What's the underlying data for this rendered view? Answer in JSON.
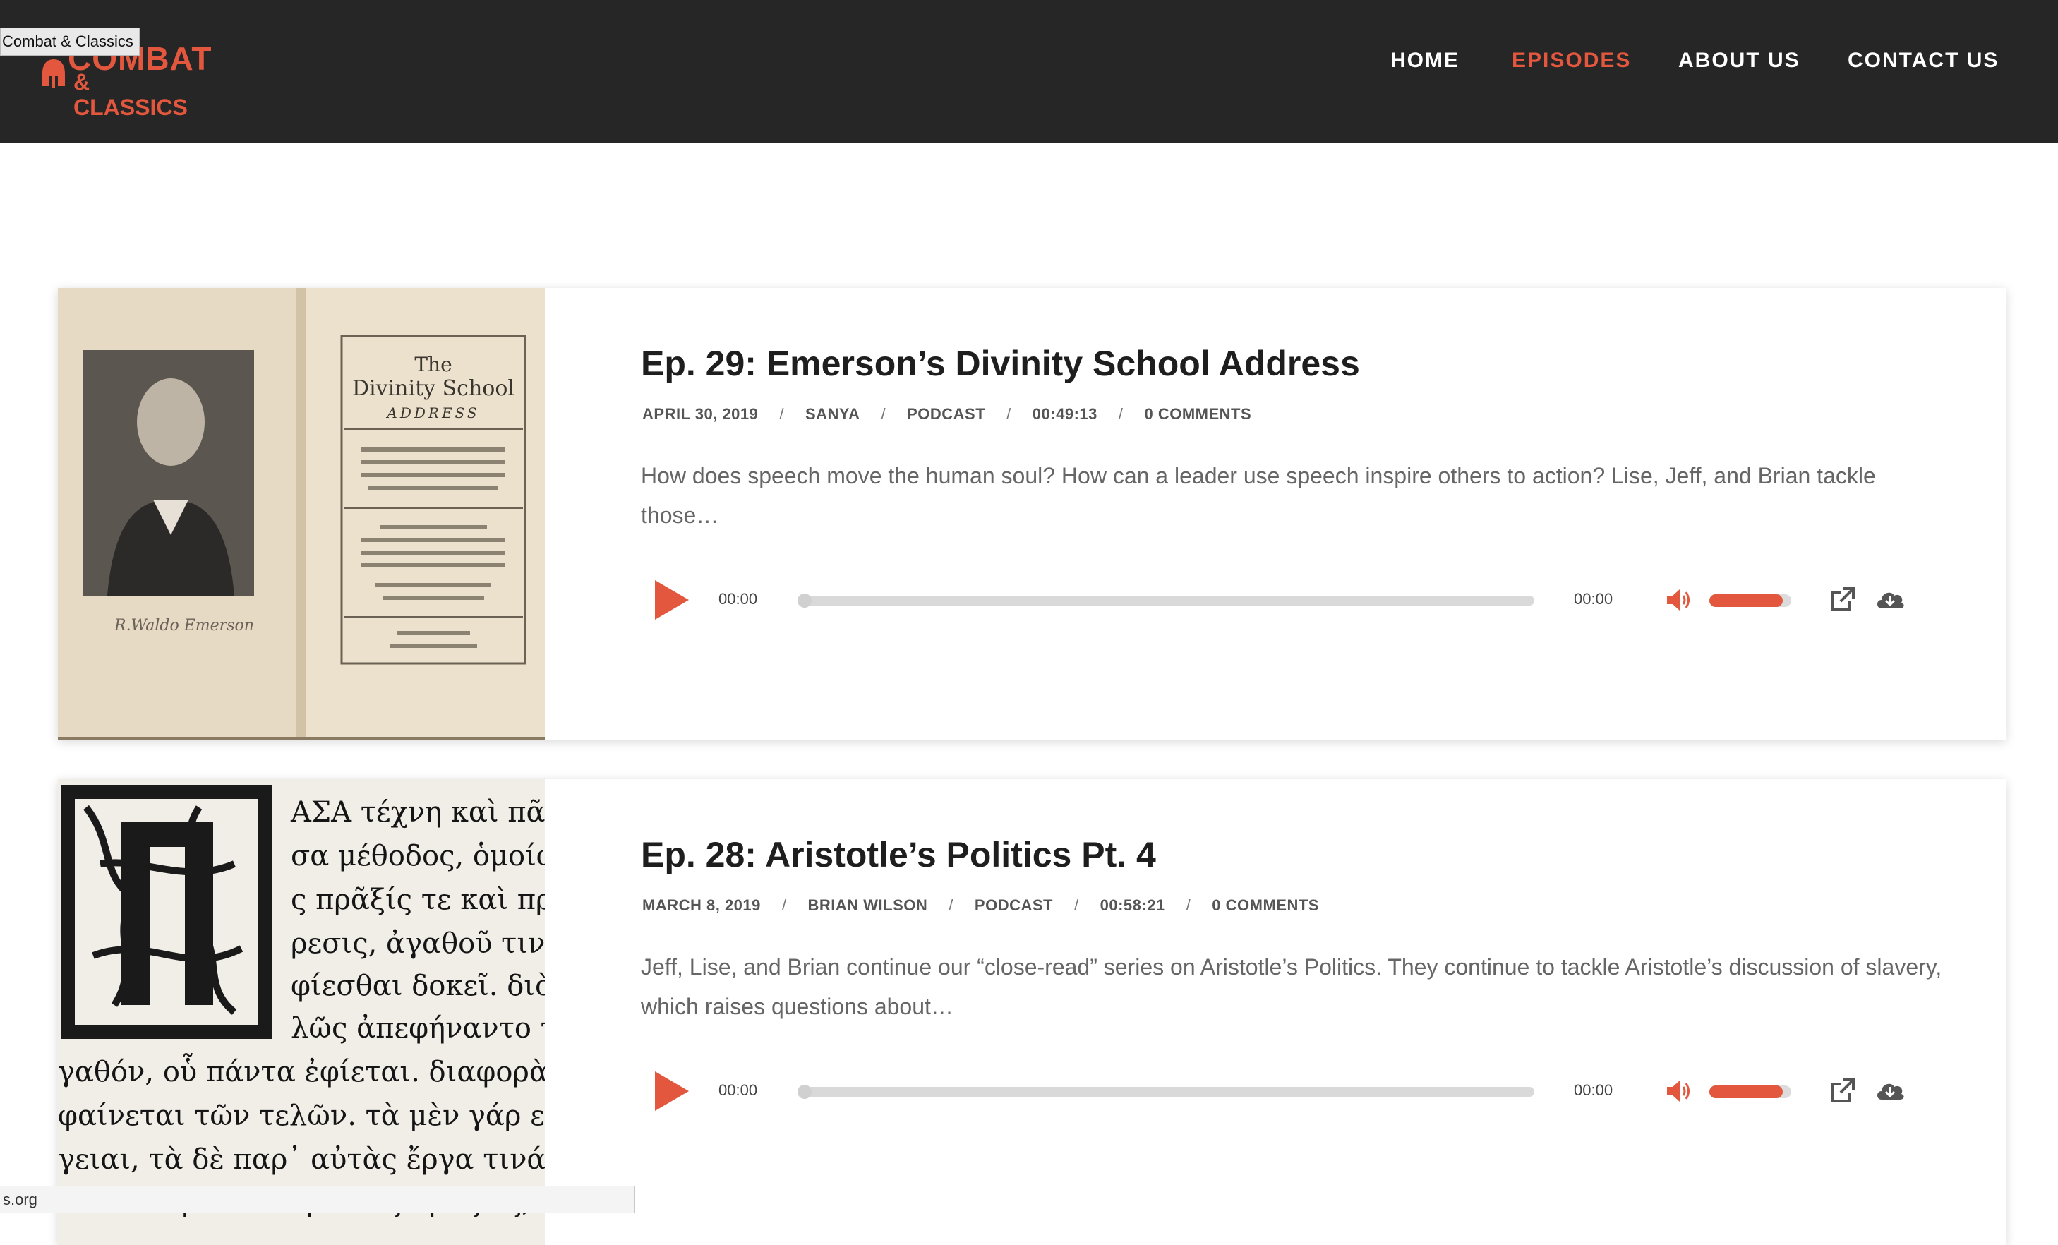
{
  "browser": {
    "tooltip": "Combat & Classics",
    "status_url": "s.org"
  },
  "site": {
    "logo_line1": "COMBAT",
    "logo_line2": "& CLASSICS",
    "brand_color": "#e2573d",
    "header_bg": "#262626"
  },
  "nav": {
    "items": [
      {
        "label": "HOME",
        "active": false
      },
      {
        "label": "EPISODES",
        "active": true
      },
      {
        "label": "ABOUT US",
        "active": false
      },
      {
        "label": "CONTACT US",
        "active": false
      }
    ]
  },
  "episodes": [
    {
      "title": "Ep. 29: Emerson’s Divinity School Address",
      "date": "APRIL 30, 2019",
      "author": "SANYA",
      "category": "PODCAST",
      "duration": "00:49:13",
      "comments": "0 COMMENTS",
      "excerpt": "How does speech move the human soul? How can a leader use speech inspire others to action? Lise, Jeff, and Brian tackle those…",
      "thumb": {
        "title_line1": "The",
        "title_line2": "Divinity School",
        "title_line3": "ADDRESS",
        "signature": "R.Waldo Emerson"
      },
      "player": {
        "current": "00:00",
        "total": "00:00",
        "volume": 0.9
      }
    },
    {
      "title": "Ep. 28: Aristotle’s Politics Pt. 4",
      "date": "MARCH 8, 2019",
      "author": "BRIAN WILSON",
      "category": "PODCAST",
      "duration": "00:58:21",
      "comments": "0 COMMENTS",
      "excerpt": "Jeff, Lise, and Brian continue our “close-read” series on Aristotle’s Politics. They continue to tackle Aristotle’s discussion of slavery, which raises questions about…",
      "thumb": {
        "lines": [
          "ΑΣΑ τέχνη καὶ πᾶ",
          "σα μέθοδος, ὁμοίω",
          "ς πρᾶξίς τε καὶ πρ",
          "ρεσις, ἀγαθοῦ τινὸς ἐ",
          "φίεσθαι δοκεῖ. διὸ κ",
          "λῶς ἀπεφήναντο τἀ",
          "γαθόν, οὗ πάντα ἐφίεται. διαφορὰ δέ τι",
          "φαίνεται τῶν τελῶν. τὰ μὲν γάρ εἰσιν ἐνέ",
          "γειαι, τὰ δὲ παρ᾽ αὐτὰς ἔργα τινά. ὧν δ",
          "εἰσὶ τέλη τινὰ παρὰ τὰς πράξεις, ἐν τούτ"
        ]
      },
      "player": {
        "current": "00:00",
        "total": "00:00",
        "volume": 0.9
      }
    }
  ]
}
